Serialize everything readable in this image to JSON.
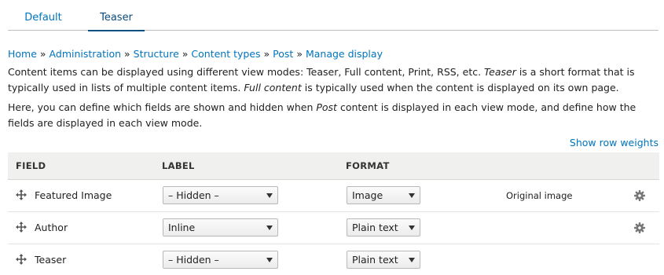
{
  "tabs": [
    {
      "label": "Default"
    },
    {
      "label": "Teaser",
      "active": true
    }
  ],
  "breadcrumb": [
    "Home",
    "Administration",
    "Structure",
    "Content types",
    "Post",
    "Manage display"
  ],
  "breadcrumb_separator": "»",
  "description": {
    "p1_a": "Content items can be displayed using different view modes: Teaser, Full content, Print, RSS, etc. ",
    "p1_em1": "Teaser",
    "p1_b": " is a short format that is typically used in lists of multiple content items. ",
    "p1_em2": "Full content",
    "p1_c": " is typically used when the content is displayed on its own page.",
    "p2_a": "Here, you can define which fields are shown and hidden when ",
    "p2_em": "Post",
    "p2_b": " content is displayed in each view mode, and define how the fields are displayed in each view mode."
  },
  "row_weights_link": "Show row weights",
  "table": {
    "headers": {
      "field": "FIELD",
      "label": "LABEL",
      "format": "FORMAT"
    },
    "rows": [
      {
        "field": "Featured Image",
        "label": "– Hidden –",
        "format": "Image",
        "summary": "Original image",
        "settings": true
      },
      {
        "field": "Author",
        "label": "Inline",
        "format": "Plain text",
        "summary": "",
        "settings": true
      },
      {
        "field": "Teaser",
        "label": "– Hidden –",
        "format": "Plain text",
        "summary": "",
        "settings": false
      }
    ]
  },
  "icons": {
    "drag": "move-cross-icon",
    "settings": "gear-icon",
    "dropdown": "caret-down-icon"
  },
  "colors": {
    "link": "#0074bd",
    "header_bg": "#f0f0ee",
    "active_tab_border": "#004f80"
  }
}
